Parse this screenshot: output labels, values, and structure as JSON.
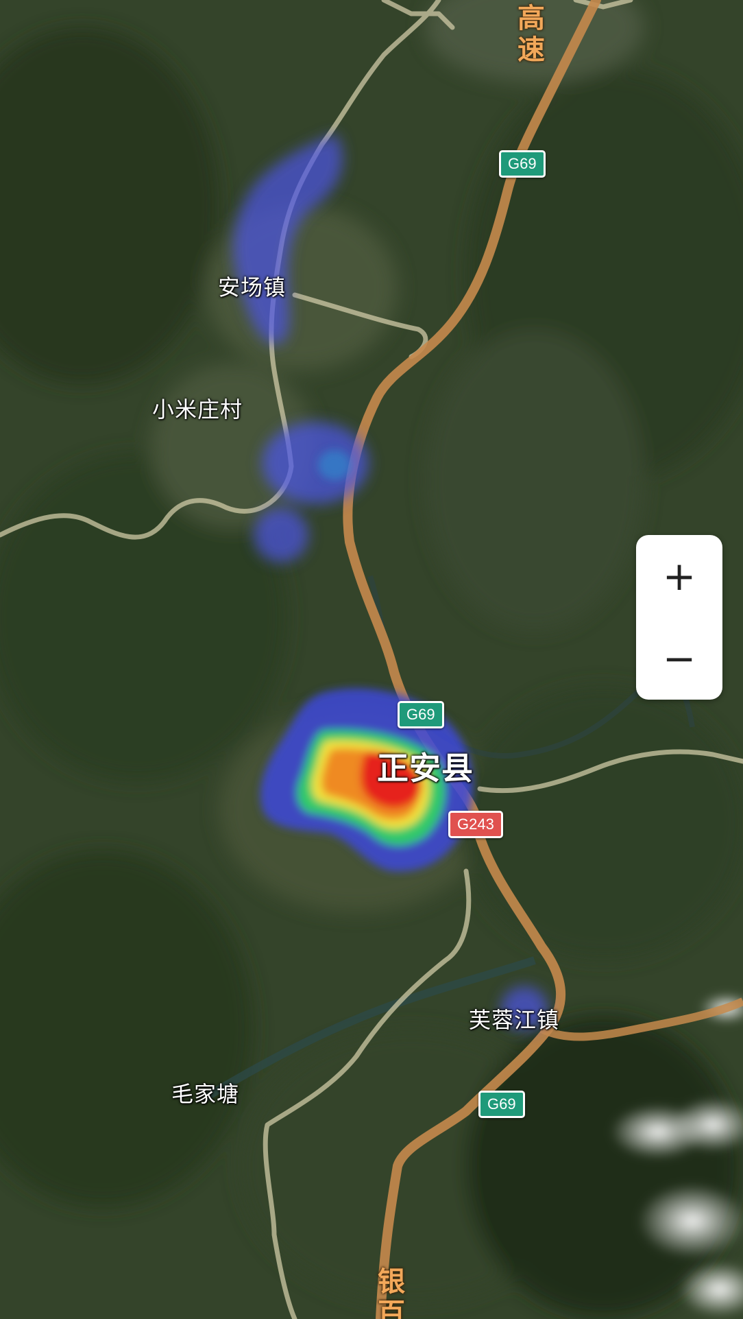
{
  "map": {
    "type": "satellite heatmap",
    "place_labels": {
      "anchang": "安场镇",
      "xiaomizhuang": "小米庄村",
      "zhengan": "正安县",
      "furongjiang": "芙蓉江镇",
      "maojiatang": "毛家塘"
    },
    "road_shields": {
      "g69_a": "G69",
      "g69_b": "G69",
      "g69_c": "G69",
      "g243": "G243"
    },
    "road_names": {
      "top": "高速",
      "bottom": "银百"
    },
    "heatmap_colors": [
      "#3a4bd6",
      "#2fd07a",
      "#f2e23a",
      "#f08a1c",
      "#e8211c"
    ],
    "shield_colors": {
      "G69": "#1f9a7a",
      "G243": "#e0514f"
    }
  },
  "controls": {
    "zoom_in_label": "+",
    "zoom_out_label": "−"
  }
}
